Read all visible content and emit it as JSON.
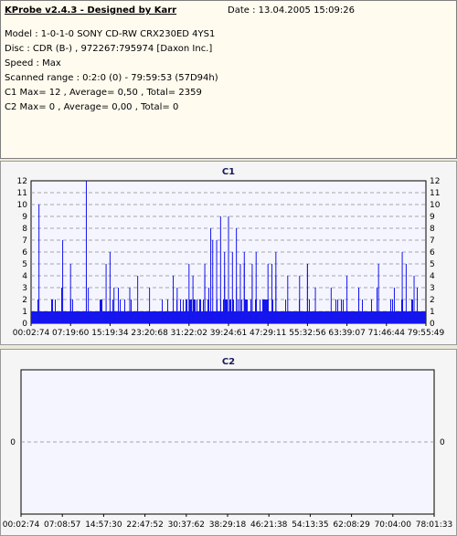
{
  "info": {
    "header": "KProbe v2.4.3 - Designed by Karr",
    "date": "Date : 13.04.2005 15:09:26",
    "lines": [
      "Model : 1-0-1-0 SONY    CD-RW  CRX230ED  4YS1",
      "Disc : CDR (B-) , 972267:795974 [Daxon Inc.]",
      "Speed : Max",
      "Scanned range : 0:2:0 (0) - 79:59:53 (57D94h)",
      "C1 Max= 12 , Average= 0,50 , Total= 2359",
      "C2 Max= 0 , Average= 0,00 , Total= 0"
    ]
  },
  "colors": {
    "bar": "#1515ee",
    "plot_bg": "#f5f5ff",
    "grid": "#8a8a8a"
  },
  "chart_data": [
    {
      "type": "bar",
      "title": "C1",
      "ylim": [
        0,
        12
      ],
      "yticks": [
        "0",
        "1",
        "2",
        "3",
        "4",
        "5",
        "6",
        "7",
        "8",
        "9",
        "10",
        "11",
        "12"
      ],
      "xtick_labels": [
        "00:02:74",
        "07:19:60",
        "15:19:34",
        "23:20:68",
        "31:22:02",
        "39:24:61",
        "47:29:11",
        "55:32:56",
        "63:39:07",
        "71:46:44",
        "79:55:49"
      ],
      "baseline": 1,
      "spikes": [
        {
          "x": 0.02,
          "v": 10
        },
        {
          "x": 0.08,
          "v": 7
        },
        {
          "x": 0.1,
          "v": 5
        },
        {
          "x": 0.14,
          "v": 4
        },
        {
          "x": 0.145,
          "v": 3
        },
        {
          "x": 0.19,
          "v": 5
        },
        {
          "x": 0.21,
          "v": 3
        },
        {
          "x": 0.25,
          "v": 3
        },
        {
          "x": 0.27,
          "v": 4
        },
        {
          "x": 0.3,
          "v": 3
        },
        {
          "x": 0.36,
          "v": 4
        },
        {
          "x": 0.37,
          "v": 3
        },
        {
          "x": 0.4,
          "v": 5
        },
        {
          "x": 0.41,
          "v": 4
        },
        {
          "x": 0.44,
          "v": 4
        },
        {
          "x": 0.45,
          "v": 3
        },
        {
          "x": 0.49,
          "v": 4
        },
        {
          "x": 0.5,
          "v": 3
        },
        {
          "x": 0.52,
          "v": 3
        },
        {
          "x": 0.54,
          "v": 5
        },
        {
          "x": 0.56,
          "v": 4
        },
        {
          "x": 0.61,
          "v": 5
        },
        {
          "x": 0.62,
          "v": 4
        },
        {
          "x": 0.65,
          "v": 4
        },
        {
          "x": 0.68,
          "v": 4
        },
        {
          "x": 0.7,
          "v": 5
        },
        {
          "x": 0.72,
          "v": 3
        },
        {
          "x": 0.76,
          "v": 3
        },
        {
          "x": 0.8,
          "v": 4
        },
        {
          "x": 0.83,
          "v": 3
        },
        {
          "x": 0.88,
          "v": 5
        },
        {
          "x": 0.92,
          "v": 3
        },
        {
          "x": 0.95,
          "v": 5
        },
        {
          "x": 0.97,
          "v": 4
        }
      ],
      "major_spikes": [
        {
          "x": 0.14,
          "v": 12
        },
        {
          "x": 0.2,
          "v": 6
        },
        {
          "x": 0.44,
          "v": 5
        },
        {
          "x": 0.455,
          "v": 8
        },
        {
          "x": 0.46,
          "v": 7
        },
        {
          "x": 0.47,
          "v": 7
        },
        {
          "x": 0.48,
          "v": 9
        },
        {
          "x": 0.49,
          "v": 6
        },
        {
          "x": 0.5,
          "v": 9
        },
        {
          "x": 0.51,
          "v": 6
        },
        {
          "x": 0.52,
          "v": 8
        },
        {
          "x": 0.53,
          "v": 5
        },
        {
          "x": 0.54,
          "v": 6
        },
        {
          "x": 0.56,
          "v": 5
        },
        {
          "x": 0.57,
          "v": 6
        },
        {
          "x": 0.6,
          "v": 5
        },
        {
          "x": 0.62,
          "v": 6
        },
        {
          "x": 0.7,
          "v": 5
        },
        {
          "x": 0.94,
          "v": 6
        }
      ]
    },
    {
      "type": "bar",
      "title": "C2",
      "ylim": [
        -1,
        1
      ],
      "yticks": [
        "0"
      ],
      "xtick_labels": [
        "00:02:74",
        "07:08:57",
        "14:57:30",
        "22:47:52",
        "30:37:62",
        "38:29:18",
        "46:21:38",
        "54:13:35",
        "62:08:29",
        "70:04:00",
        "78:01:33"
      ],
      "values": []
    }
  ]
}
